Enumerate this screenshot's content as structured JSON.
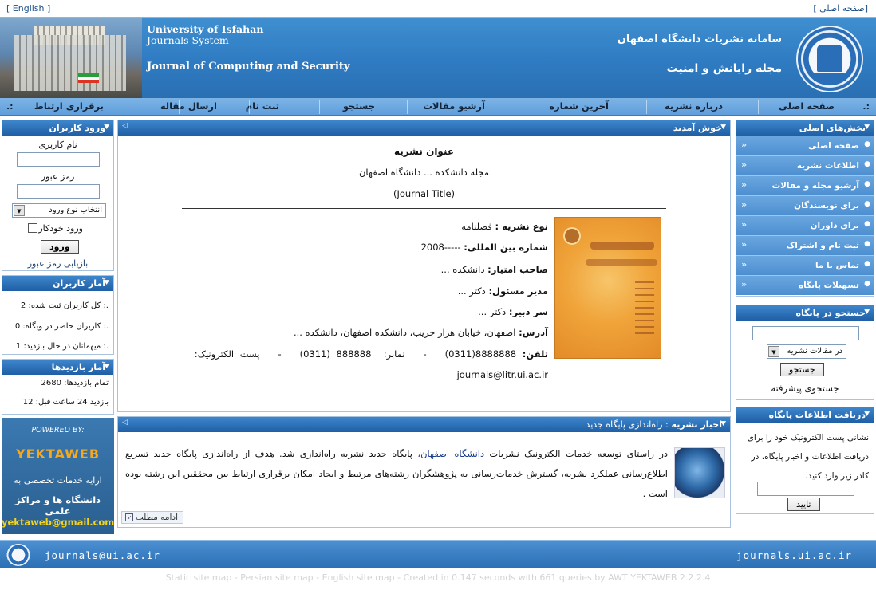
{
  "topbar": {
    "english_link": "[ English ]",
    "home_link": "[صفحه اصلی ]"
  },
  "header": {
    "university_en": "University of Isfahan",
    "system_en": "Journals System",
    "journal_en": "Journal of Computing and Security",
    "system_fa": "سامانه نشريات دانشگاه اصفهان",
    "journal_fa": "مجله رايانش و امنيت"
  },
  "nav": {
    "items": [
      "صفحه اصلی",
      "درباره نشريه",
      "آخرين شماره",
      "آرشيو مقالات",
      "جستجو",
      "ثبت نام",
      "ارسال مقاله",
      "برقراری ارتباط"
    ],
    "dot": ".:"
  },
  "login": {
    "title": "ورود کاربران",
    "username_label": "نام کاربری",
    "password_label": "رمز عبور",
    "login_type": "انتخاب نوع ورود",
    "remember_label": "ورود خودکار",
    "submit": "ورود",
    "recover": "بازيابی رمز عبور"
  },
  "user_stats": {
    "title": "آمار کاربران",
    "rows": [
      ".: کل کاربران ثبت شده: 2",
      ".: کاربران حاضر در وبگاه: 0",
      ".: ميهمانان در حال بازديد: 1"
    ]
  },
  "visit_stats": {
    "title": "آمار بازديدها",
    "rows": [
      "تمام بازديدها: 2680",
      "بازديد 24 ساعت قبل: 12"
    ]
  },
  "powered": {
    "label": "POWERED BY:",
    "brand": "YEKTAWEB",
    "line1": "ارايه خدمات تخصصی به",
    "line2": "دانشگاه ها و مراکز علمی",
    "email": "yektaweb@gmail.com"
  },
  "welcome": {
    "title": "خوش آمديد",
    "heading": "عنوان نشريه",
    "faculty": "مجله دانشکده ... دانشگاه اصفهان",
    "journal_title": "(Journal Title)",
    "fields": [
      {
        "label": "نوع نشريه :",
        "value": "فصلنامه"
      },
      {
        "label": "شماره بين المللی:",
        "value": "-----2008"
      },
      {
        "label": "صاحب امتياز:",
        "value": "دانشکده ..."
      },
      {
        "label": "مدير مسئول:",
        "value": "دکتر ..."
      },
      {
        "label": "سر دبير:",
        "value": "دکتر ..."
      },
      {
        "label": "آدرس:",
        "value": "اصفهان، خيابان هزار جريب، دانشکده اصفهان، دانشکده ..."
      }
    ],
    "phone_label": "تلفن:",
    "phone_value": "8888888(0311)",
    "fax_label": "نمابر:",
    "fax_value": "888888 (0311)",
    "email_label": "پست الکترونيک:",
    "dash": "-",
    "email": "journals@litr.ui.ac.ir"
  },
  "news": {
    "title": "اخبار نشريه",
    "subtitle": ": راه‌اندازی پايگاه جديد",
    "text_before": "در راستای توسعه خدمات الکترونيک نشريات ",
    "link": "دانشگاه اصفهان،",
    "text_after": " پايگاه جديد نشريه راه‌اندازی شد. هدف از راه‌اندازی پايگاه جديد تسريع اطلاع‌رسانی عملکرد نشريه، گسترش خدمات‌رسانی به پژوهشگران رشته‌های مرتبط و ايجاد امکان برقراری ارتباط بين محققين اين رشته بوده است .",
    "more": "ادامه مطلب"
  },
  "sections": {
    "title": "بخش‌های اصلی",
    "items": [
      "صفحه اصلی",
      "اطلاعات نشريه",
      "آرشيو مجله و مقالات",
      "برای نويسندگان",
      "برای داوران",
      "ثبت نام و اشتراک",
      "تماس با ما",
      "تسهيلات پايگاه"
    ]
  },
  "search": {
    "title": "جستجو در پايگاه",
    "scope": "در مقالات نشريه",
    "button": "جستجو",
    "advanced": "جستجوی پيشرفته"
  },
  "newsletter": {
    "title": "دريافت اطلاعات پايگاه",
    "text": "نشانی پست الکترونيک خود را برای دريافت اطلاعات و اخبار پايگاه، در کادر زير وارد کنيد.",
    "button": "تاييد"
  },
  "footer": {
    "email": "journals@ui.ac.ir",
    "site": "journals.ui.ac.ir",
    "credit": "Static site map - Persian site map - English site map - Created in 0.147 seconds with 661 queries by AWT YEKTAWEB 2.2.2.4"
  }
}
